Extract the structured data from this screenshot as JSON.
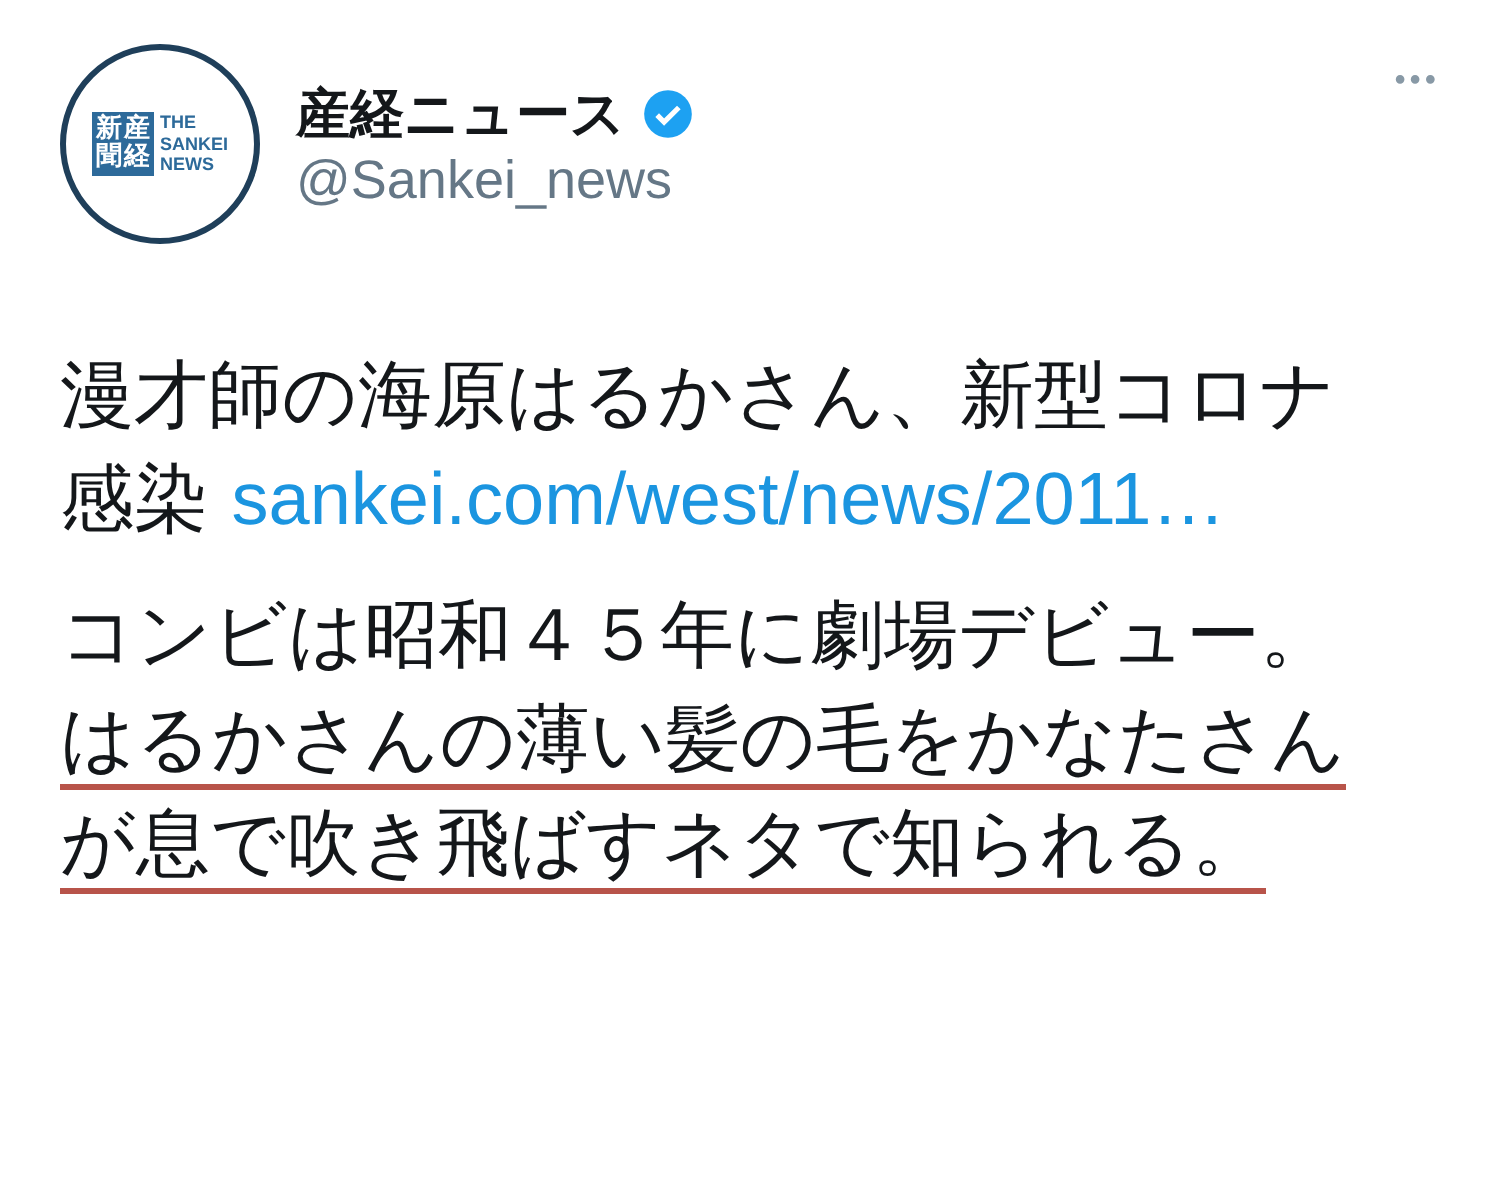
{
  "account": {
    "name": "産経ニュース",
    "handle": "@Sankei_news",
    "verified": true,
    "logo": {
      "kanji_right": "産経",
      "kanji_left": "新聞",
      "lines": [
        "THE",
        "SANKEI",
        "NEWS"
      ]
    }
  },
  "more_button": "•••",
  "paragraphs": [
    {
      "segments": [
        {
          "kind": "text",
          "text": "漫才師の海原はるかさん、新型コロナ感染 ",
          "highlighted": false
        },
        {
          "kind": "link",
          "text": "sankei.com/west/news/2011…",
          "highlighted": false
        }
      ]
    },
    {
      "segments": [
        {
          "kind": "text",
          "text": "コンビは昭和４５年に劇場デビュー。",
          "highlighted": false
        },
        {
          "kind": "text",
          "text": "はるかさんの薄い髪の毛をかなたさんが息で吹き飛ばすネタで知られる。",
          "highlighted": true
        }
      ]
    }
  ]
}
